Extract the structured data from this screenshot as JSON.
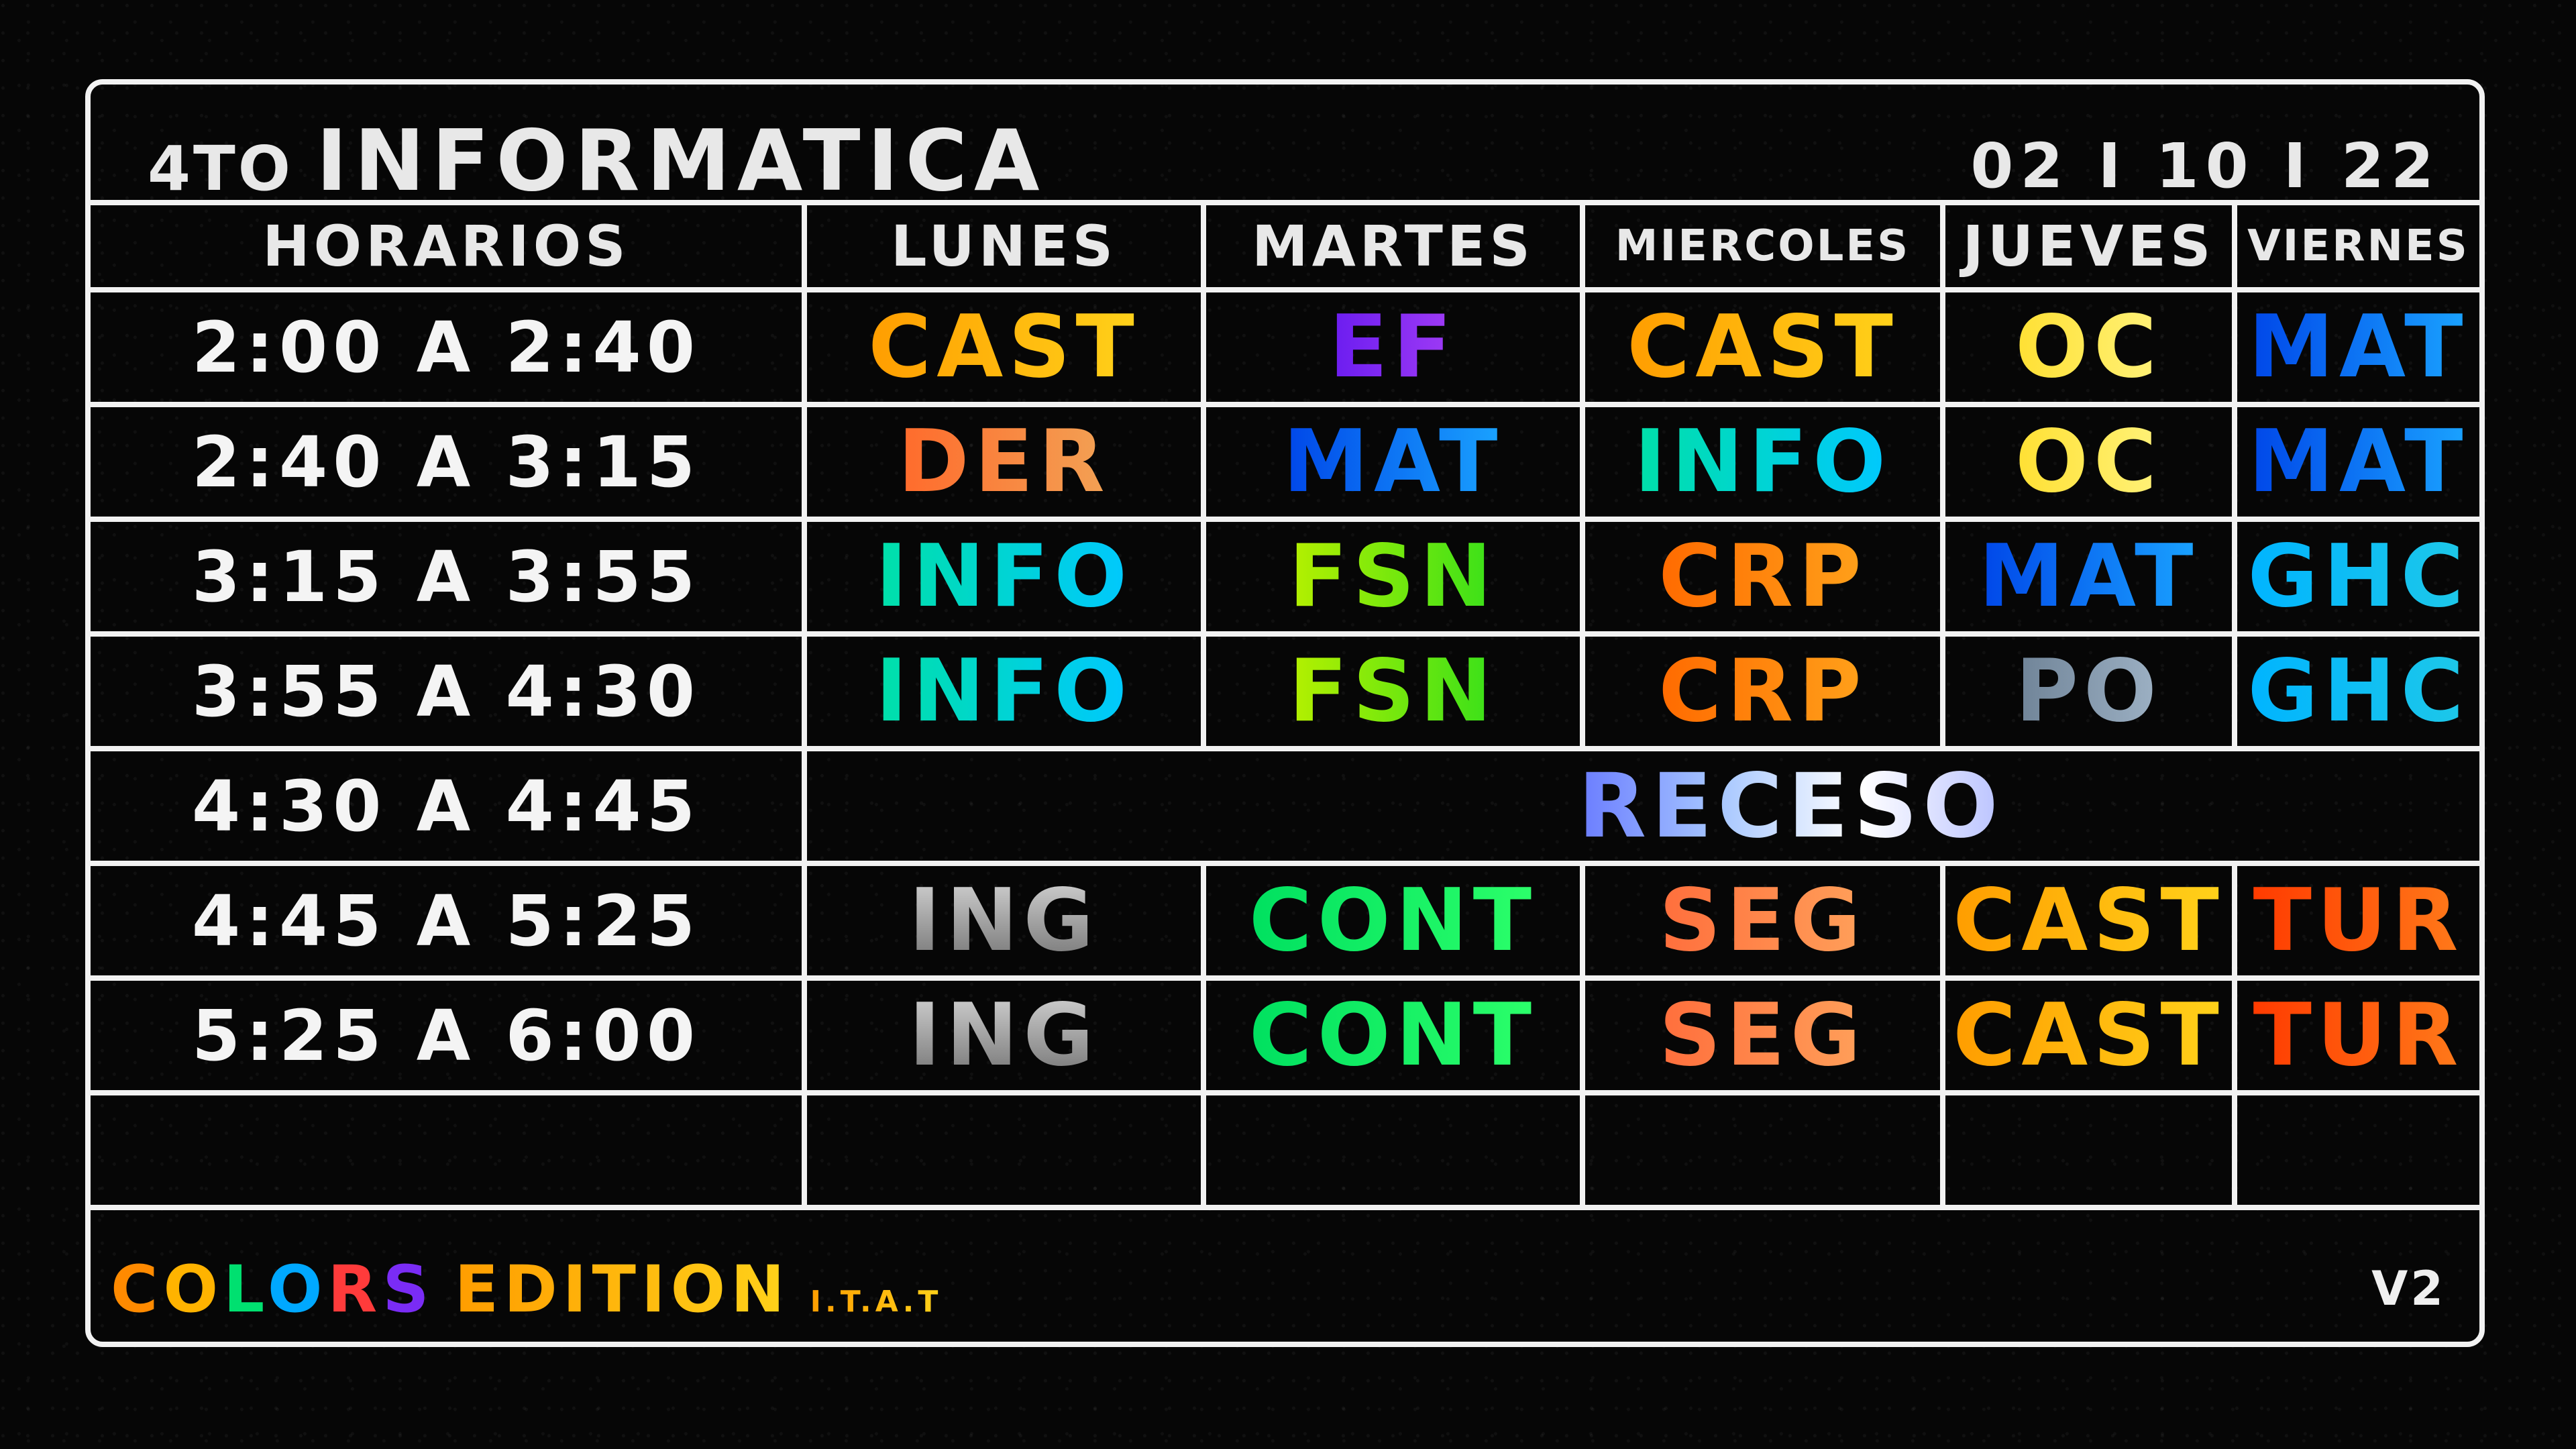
{
  "header": {
    "grade": "4TO",
    "title": "INFORMATICA",
    "date": "02 I 10 I 22"
  },
  "columns": [
    "HORARIOS",
    "LUNES",
    "MARTES",
    "MIERCOLES",
    "JUEVES",
    "VIERNES"
  ],
  "rows": [
    {
      "time": "2:00 A 2:40",
      "subjects": [
        "CAST",
        "EF",
        "CAST",
        "OC",
        "MAT"
      ]
    },
    {
      "time": "2:40 A 3:15",
      "subjects": [
        "DER",
        "MAT",
        "INFO",
        "OC",
        "MAT"
      ]
    },
    {
      "time": "3:15 A 3:55",
      "subjects": [
        "INFO",
        "FSN",
        "CRP",
        "MAT",
        "GHC"
      ]
    },
    {
      "time": "3:55 A 4:30",
      "subjects": [
        "INFO",
        "FSN",
        "CRP",
        "PO",
        "GHC"
      ]
    },
    {
      "time": "4:30 A 4:45",
      "recess": "RECESO"
    },
    {
      "time": "4:45 A 5:25",
      "subjects": [
        "ING",
        "CONT",
        "SEG",
        "CAST",
        "TUR"
      ]
    },
    {
      "time": "5:25 A 6:00",
      "subjects": [
        "ING",
        "CONT",
        "SEG",
        "CAST",
        "TUR"
      ]
    }
  ],
  "footer": {
    "colors_letters": [
      "C",
      "O",
      "L",
      "O",
      "R",
      "S"
    ],
    "colors_palette": [
      "#ff8a00",
      "#ffb300",
      "#00e070",
      "#00a8ff",
      "#ff3b3b",
      "#7a2cf5"
    ],
    "edition": "EDITION",
    "institution": "I.T.A.T",
    "version": "V2"
  }
}
